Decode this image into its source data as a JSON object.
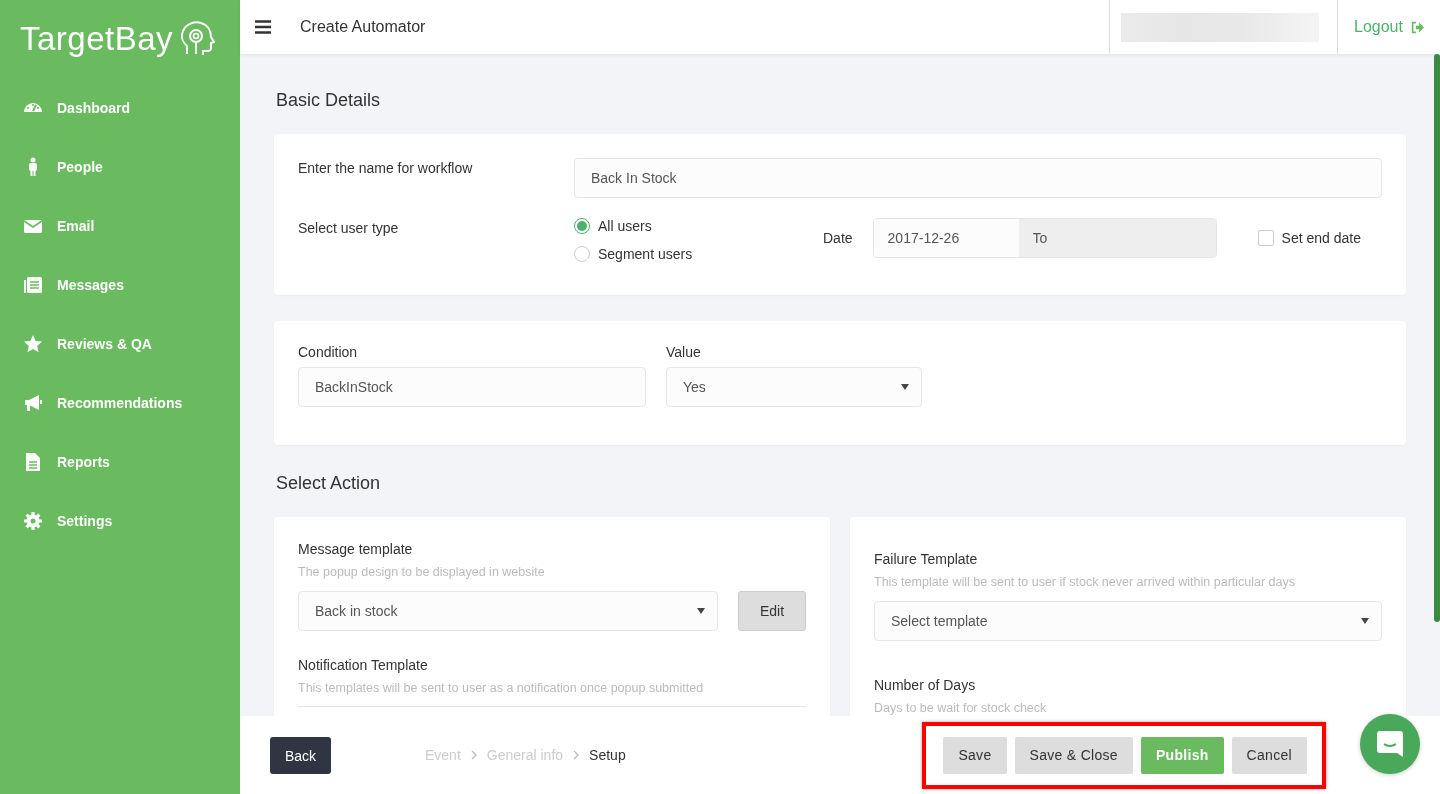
{
  "sidebar": {
    "logo": "TargetBay",
    "items": [
      {
        "label": "Dashboard",
        "selected": false
      },
      {
        "label": "People",
        "selected": false
      },
      {
        "label": "Email",
        "selected": false
      },
      {
        "label": "Messages",
        "selected": false
      },
      {
        "label": "Reviews & QA",
        "selected": false
      },
      {
        "label": "Recommendations",
        "selected": false
      },
      {
        "label": "Reports",
        "selected": false
      },
      {
        "label": "Settings",
        "selected": false
      }
    ]
  },
  "header": {
    "title": "Create Automator",
    "logout": "Logout"
  },
  "basic_details": {
    "heading": "Basic Details",
    "name_label": "Enter the name for workflow",
    "name_value": "Back In Stock",
    "user_type_label": "Select user type",
    "user_types": [
      {
        "label": "All users",
        "selected": true
      },
      {
        "label": "Segment users",
        "selected": false
      }
    ],
    "date_label": "Date",
    "date_from": "2017-12-26",
    "date_to_placeholder": "To",
    "set_end_date": {
      "label": "Set end date",
      "checked": false
    }
  },
  "condition": {
    "condition_label": "Condition",
    "condition_value": "BackInStock",
    "value_label": "Value",
    "value": "Yes"
  },
  "select_action": {
    "heading": "Select Action",
    "message_template": {
      "label": "Message template",
      "hint": "The popup design to be displayed in website",
      "value": "Back in stock",
      "edit_button": "Edit"
    },
    "notification_template": {
      "label": "Notification Template",
      "hint": "This templates will be sent to user as a notification once popup submitted"
    },
    "failure_template": {
      "label": "Failure Template",
      "hint": "This template will be sent to user if stock never arrived within particular days",
      "value": "Select template"
    },
    "number_of_days": {
      "label": "Number of Days",
      "hint": "Days to be wait for stock check"
    }
  },
  "footer": {
    "back": "Back",
    "steps": [
      {
        "label": "Event",
        "current": false
      },
      {
        "label": "General info",
        "current": false
      },
      {
        "label": "Setup",
        "current": true
      }
    ],
    "buttons": [
      {
        "label": "Save",
        "kind": "secondary"
      },
      {
        "label": "Save & Close",
        "kind": "secondary"
      },
      {
        "label": "Publish",
        "kind": "primary"
      },
      {
        "label": "Cancel",
        "kind": "secondary"
      }
    ],
    "highlighted": true
  }
}
